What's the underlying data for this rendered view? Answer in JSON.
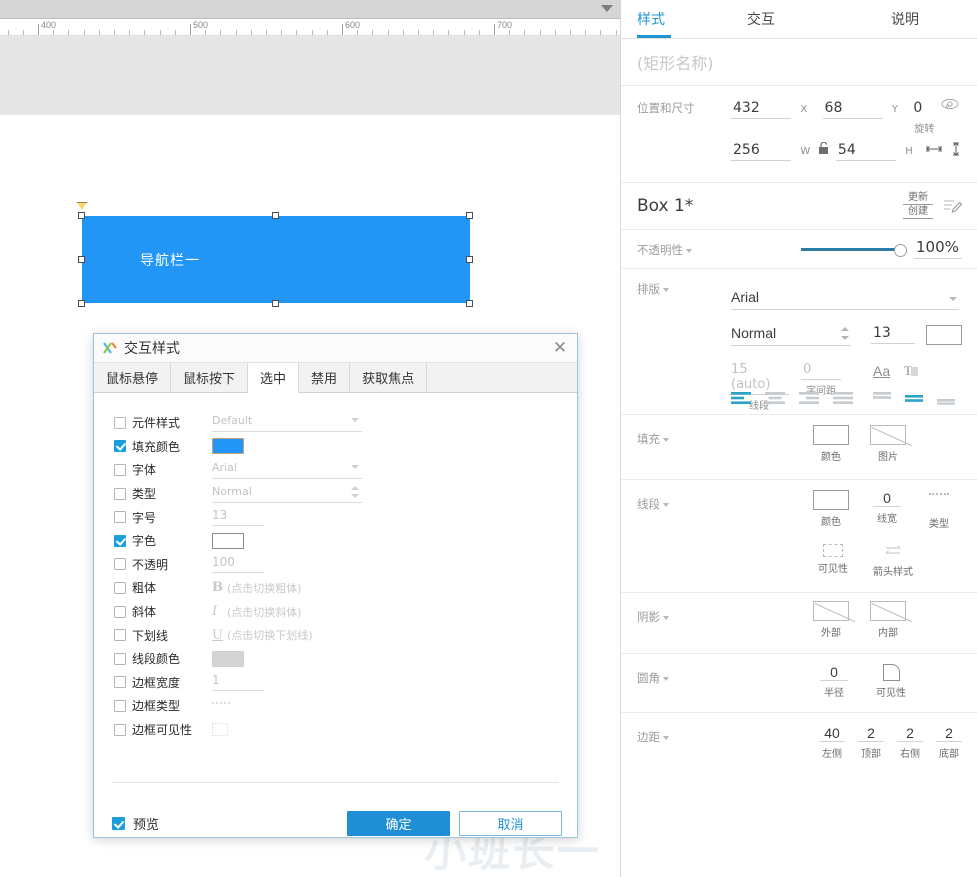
{
  "canvas": {
    "ruler": {
      "labels": [
        "400",
        "500",
        "600",
        "700"
      ]
    },
    "shape": {
      "text": "导航栏一",
      "fill_color": "#2196f7",
      "text_color": "#ffffff"
    },
    "watermark": "小班长一"
  },
  "dialog": {
    "title": "交互样式",
    "logo_name": "axure-logo-icon",
    "close_label": "✕",
    "tabs": [
      {
        "label": "鼠标悬停",
        "active": false
      },
      {
        "label": "鼠标按下",
        "active": false
      },
      {
        "label": "选中",
        "active": true
      },
      {
        "label": "禁用",
        "active": false
      },
      {
        "label": "获取焦点",
        "active": false
      }
    ],
    "properties": [
      {
        "label": "元件样式",
        "checked": false,
        "control": "select",
        "value": "Default"
      },
      {
        "label": "填充颜色",
        "checked": true,
        "control": "swatch",
        "value": "#2196f7"
      },
      {
        "label": "字体",
        "checked": false,
        "control": "select",
        "value": "Arial"
      },
      {
        "label": "类型",
        "checked": false,
        "control": "spin",
        "value": "Normal"
      },
      {
        "label": "字号",
        "checked": false,
        "control": "num",
        "value": "13"
      },
      {
        "label": "字色",
        "checked": true,
        "control": "swatch-plain",
        "value": "#ffffff"
      },
      {
        "label": "不透明",
        "checked": false,
        "control": "num",
        "value": "100"
      },
      {
        "label": "粗体",
        "checked": false,
        "control": "toggle",
        "glyph": "B",
        "value": "(点击切换粗体)"
      },
      {
        "label": "斜体",
        "checked": false,
        "control": "toggle",
        "glyph": "I",
        "value": "(点击切换斜体)"
      },
      {
        "label": "下划线",
        "checked": false,
        "control": "toggle",
        "glyph": "U",
        "value": "(点击切换下划线)"
      },
      {
        "label": "线段颜色",
        "checked": false,
        "control": "swatch-grey",
        "value": "#d4d4d4"
      },
      {
        "label": "边框宽度",
        "checked": false,
        "control": "num",
        "value": "1"
      },
      {
        "label": "边框类型",
        "checked": false,
        "control": "dash",
        "value": ""
      },
      {
        "label": "边框可见性",
        "checked": false,
        "control": "visbox",
        "value": ""
      }
    ],
    "footer": {
      "preview_label": "预览",
      "preview_checked": true,
      "ok_label": "确定",
      "cancel_label": "取消"
    }
  },
  "right_panel": {
    "tabs": [
      {
        "label": "样式",
        "active": true
      },
      {
        "label": "交互",
        "active": false
      },
      {
        "label": "说明",
        "active": false
      }
    ],
    "name_placeholder": "(矩形名称)",
    "position": {
      "section_label": "位置和尺寸",
      "x": "432",
      "x_unit": "X",
      "y": "68",
      "y_unit": "Y",
      "rotation": "0",
      "rotation_unit": "°",
      "rotation_caption": "旋转",
      "w": "256",
      "w_unit": "W",
      "h": "54",
      "h_unit": "H"
    },
    "style": {
      "name": "Box 1*",
      "update_label": "更新",
      "create_label": "创建"
    },
    "opacity": {
      "section_label": "不透明性",
      "value": "100%",
      "percent": 100
    },
    "typography": {
      "section_label": "排版",
      "font_family": "Arial",
      "font_weight": "Normal",
      "font_size": "13",
      "font_color": "#ffffff",
      "line_height": "15 (auto)",
      "line_height_caption": "线段",
      "letter_spacing": "0",
      "letter_spacing_caption": "字间距",
      "case_icon": "Aa",
      "shadow_icon": "T",
      "h_align_active": 0,
      "v_align_active": 1
    },
    "fill": {
      "section_label": "填充",
      "color_caption": "颜色",
      "color_value": "#0d1a33",
      "image_caption": "图片"
    },
    "line": {
      "section_label": "线段",
      "color_caption": "颜色",
      "color_value": "#8a8a8a",
      "width_value": "0",
      "width_caption": "线宽",
      "type_caption": "类型",
      "visibility_caption": "可见性",
      "arrow_caption": "箭头样式"
    },
    "shadow": {
      "section_label": "阴影",
      "outer_caption": "外部",
      "inner_caption": "内部"
    },
    "corner": {
      "section_label": "圆角",
      "radius_value": "0",
      "radius_caption": "半径",
      "visibility_caption": "可见性"
    },
    "padding": {
      "section_label": "边距",
      "left": "40",
      "left_caption": "左侧",
      "top": "2",
      "top_caption": "顶部",
      "right": "2",
      "right_caption": "右侧",
      "bottom": "2",
      "bottom_caption": "底部"
    }
  },
  "colors": {
    "accent": "#2196d3",
    "shape_blue": "#2196f7",
    "ok_button": "#1e8fd5"
  }
}
